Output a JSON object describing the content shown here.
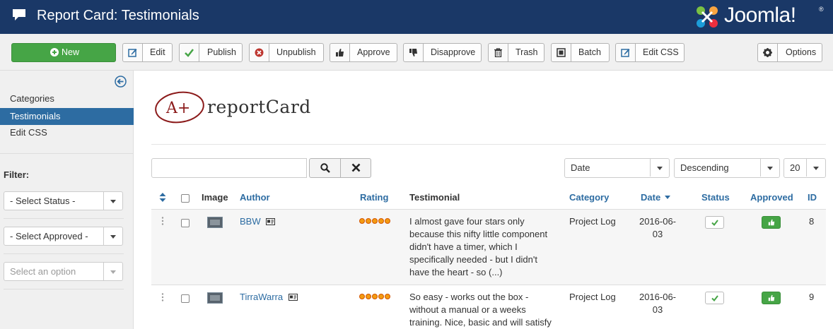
{
  "header": {
    "title": "Report Card: Testimonials",
    "logo_text": "Joomla!",
    "logo_reg": "®"
  },
  "toolbar": {
    "new": "New",
    "edit": "Edit",
    "publish": "Publish",
    "unpublish": "Unpublish",
    "approve": "Approve",
    "disapprove": "Disapprove",
    "trash": "Trash",
    "batch": "Batch",
    "edit_css": "Edit CSS",
    "options": "Options"
  },
  "sidebar": {
    "items": [
      {
        "label": "Categories"
      },
      {
        "label": "Testimonials"
      },
      {
        "label": "Edit CSS"
      }
    ],
    "filter_label": "Filter:",
    "status_select": "- Select Status -",
    "approved_select": "- Select Approved -",
    "option_select": "Select an option"
  },
  "brand": {
    "grade": "A+",
    "name": "reportCard"
  },
  "list_controls": {
    "search_value": "",
    "ordering": "Date",
    "direction": "Descending",
    "limit": "20"
  },
  "table": {
    "headers": {
      "image": "Image",
      "author": "Author",
      "rating": "Rating",
      "testimonial": "Testimonial",
      "category": "Category",
      "date": "Date",
      "status": "Status",
      "approved": "Approved",
      "id": "ID"
    },
    "rows": [
      {
        "author": "BBW",
        "rating": 5,
        "testimonial_lines": [
          "I almost gave four stars only",
          "because this nifty little component",
          "didn't have a timer, which I",
          "specifically needed - but I didn't",
          "have the heart - so (...)"
        ],
        "category": "Project Log",
        "date_line1": "2016-06-",
        "date_line2": "03",
        "status": "published",
        "approved": true,
        "id": "8"
      },
      {
        "author": "TirraWarra",
        "rating": 5,
        "testimonial_lines": [
          "So easy - works out the box -",
          "without a manual or a weeks",
          "training. Nice, basic and will satisfy"
        ],
        "category": "Project Log",
        "date_line1": "2016-06-",
        "date_line2": "03",
        "status": "published",
        "approved": true,
        "id": "9"
      }
    ]
  },
  "colors": {
    "header_bg": "#1a3867",
    "accent": "#2d6ca2",
    "new_button": "#46a546",
    "approved": "#46a546",
    "star": "#f39c12"
  }
}
